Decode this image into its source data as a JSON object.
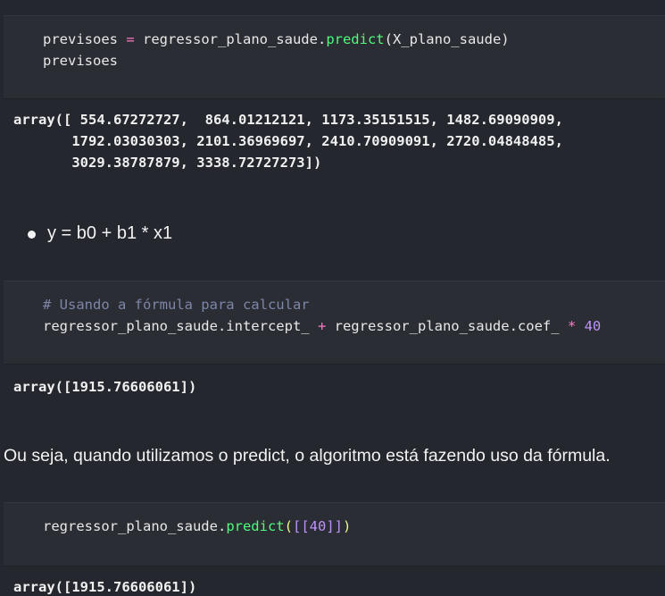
{
  "cells": [
    {
      "code_lines": [
        [
          "previsoes ",
          "=",
          " regressor_plano_saude.",
          "predict",
          "(X_plano_saude)"
        ],
        [
          "previsoes"
        ]
      ],
      "output_lines": [
        "array([ 554.67272727,  864.01212121, 1173.35151515, 1482.69090909,",
        "       1792.03030303, 2101.36969697, 2410.70909091, 2720.04848485,",
        "       3029.38787879, 3338.72727273])"
      ]
    },
    {
      "comment": "# Usando a fórmula para calcular",
      "code_a": "regressor_plano_saude.intercept_ ",
      "op_plus": "+",
      "code_b": " regressor_plano_saude.coef_ ",
      "op_mul": "*",
      "num": " 40",
      "output": "array([1915.76606061])"
    },
    {
      "code_a": "regressor_plano_saude.",
      "fn": "predict",
      "paren_open": "(",
      "bracket_open": "[[",
      "num": "40",
      "bracket_close": "]]",
      "paren_close": ")",
      "output": "array([1915.76606061])"
    }
  ],
  "markdown": {
    "bullet": "y = b0 + b1 * x1",
    "paragraph": "Ou seja, quando utilizamos o predict, o algoritmo está fazendo uso da fórmula."
  }
}
